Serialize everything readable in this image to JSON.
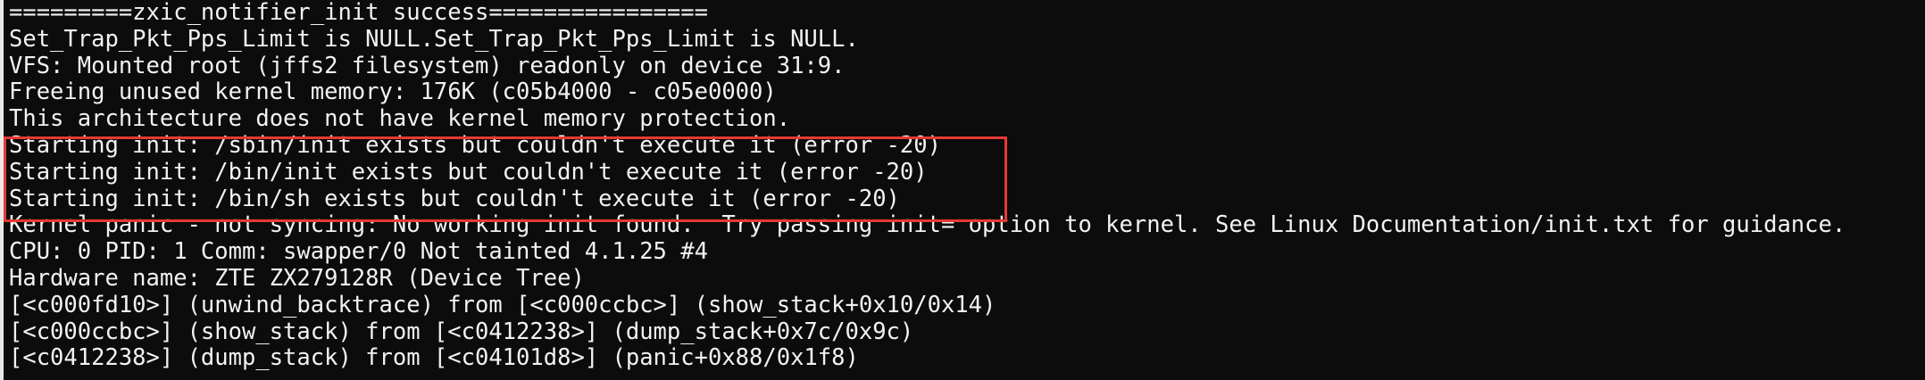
{
  "terminal": {
    "lines": [
      "=========zxic_notifier_init success================",
      "Set_Trap_Pkt_Pps_Limit is NULL.Set_Trap_Pkt_Pps_Limit is NULL.",
      "VFS: Mounted root (jffs2 filesystem) readonly on device 31:9.",
      "Freeing unused kernel memory: 176K (c05b4000 - c05e0000)",
      "This architecture does not have kernel memory protection.",
      "Starting init: /sbin/init exists but couldn't execute it (error -20)",
      "Starting init: /bin/init exists but couldn't execute it (error -20)",
      "Starting init: /bin/sh exists but couldn't execute it (error -20)",
      "Kernel panic - not syncing: No working init found.  Try passing init= option to kernel. See Linux Documentation/init.txt for guidance.",
      "CPU: 0 PID: 1 Comm: swapper/0 Not tainted 4.1.25 #4",
      "Hardware name: ZTE ZX279128R (Device Tree)",
      "[<c000fd10>] (unwind_backtrace) from [<c000ccbc>] (show_stack+0x10/0x14)",
      "[<c000ccbc>] (show_stack) from [<c0412238>] (dump_stack+0x7c/0x9c)",
      "[<c0412238>] (dump_stack) from [<c04101d8>] (panic+0x88/0x1f8)"
    ],
    "highlight": {
      "color": "#e53935",
      "covers_lines": [
        6,
        7,
        8
      ]
    },
    "colors": {
      "background": "#0c0c0c",
      "text": "#f2f2f2"
    }
  }
}
